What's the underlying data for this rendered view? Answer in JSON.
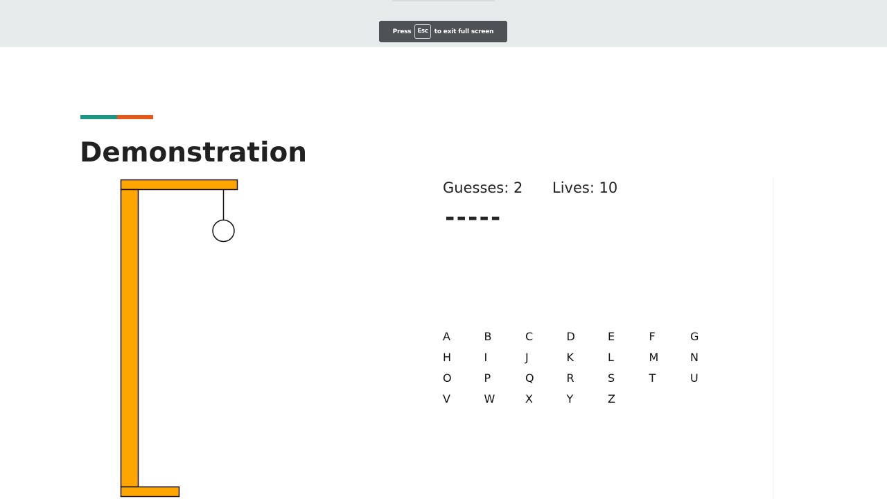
{
  "fullscreen_notice": {
    "prefix": "Press",
    "key": "Esc",
    "suffix": "to exit full screen"
  },
  "slide": {
    "title": "Demonstration",
    "accent_colors": {
      "teal": "#1e9582",
      "orange": "#e2581a"
    }
  },
  "game": {
    "guesses_text": "Guesses: 2",
    "lives_text": "Lives: 10",
    "masked_word": "-----",
    "gallows_color": "#ffa500",
    "letters": [
      "A",
      "B",
      "C",
      "D",
      "E",
      "F",
      "G",
      "H",
      "I",
      "J",
      "K",
      "L",
      "M",
      "N",
      "O",
      "P",
      "Q",
      "R",
      "S",
      "T",
      "U",
      "V",
      "W",
      "X",
      "Y",
      "Z"
    ]
  }
}
